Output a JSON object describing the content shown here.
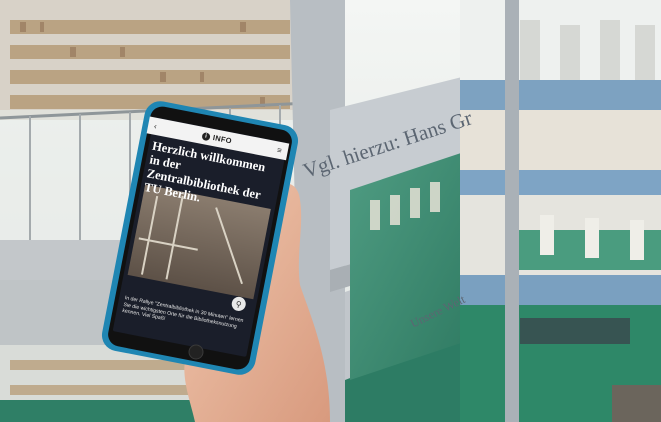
{
  "phone": {
    "back_glyph": "‹",
    "header_label": "INFO",
    "info_glyph": "i",
    "menu_glyph": "≡",
    "welcome_text": "Herzlich willkommen in der Zentralbibliothek der TU Berlin.",
    "caption": "In der Rallye \"Zentralbibliothek in 30 Minuten\" lernen Sie die wichtigsten Orte für die Bibliotheksnutzung kennen. Viel Spaß!",
    "zoom_icon": "search-icon"
  },
  "wall": {
    "inscription": "Vgl. hierzu: Hans Gr",
    "inscription_lower": "Unsere Welt"
  },
  "colors": {
    "concrete": "#c9ccd0",
    "floor_green": "#3e8f75",
    "phone_blue": "#1f86b3",
    "screen_dark": "#1a1e2a"
  }
}
